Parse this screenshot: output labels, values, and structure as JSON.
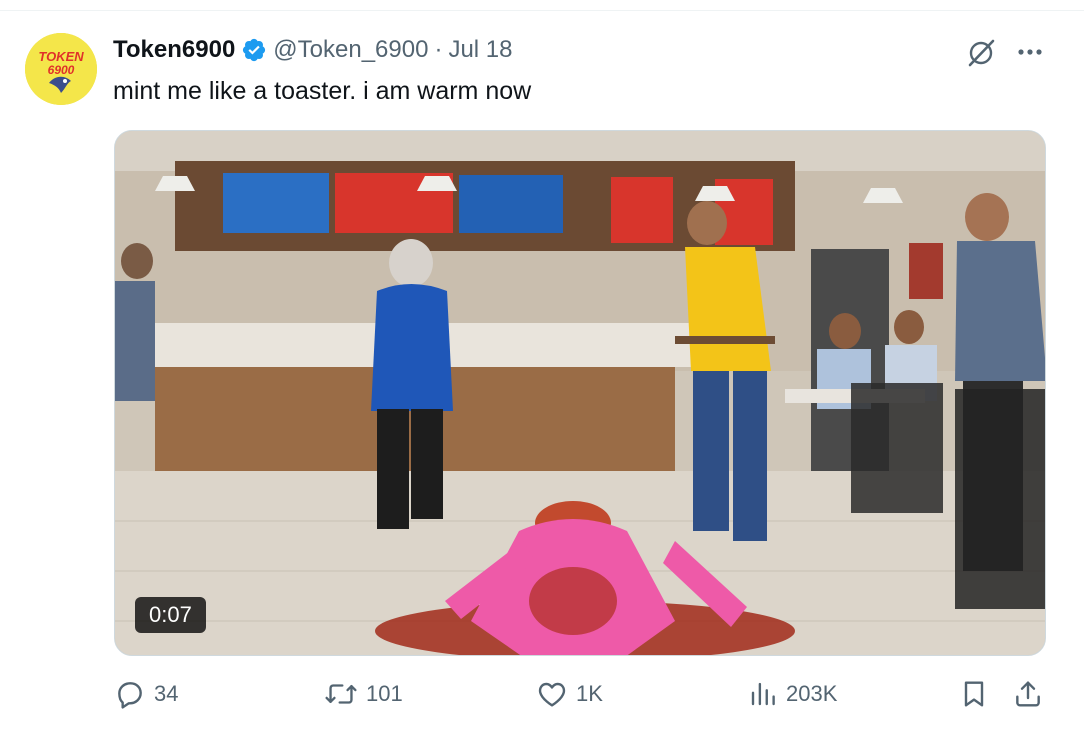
{
  "tweet": {
    "author_name": "Token6900",
    "handle": "@Token_6900",
    "separator": "·",
    "date": "Jul 18",
    "text": "mint me like a toaster. i am warm now",
    "avatar_text": "TOKEN 6900",
    "video_duration": "0:07"
  },
  "stats": {
    "replies": "34",
    "reposts": "101",
    "likes": "1K",
    "views": "203K"
  },
  "icons": {
    "verified": "verified-badge-icon",
    "grok": "grok-icon",
    "more": "more-dots-icon",
    "reply": "reply-icon",
    "repost": "repost-icon",
    "like": "heart-icon",
    "views": "views-bars-icon",
    "bookmark": "bookmark-icon",
    "share": "share-icon"
  },
  "colors": {
    "text_primary": "#0f1419",
    "text_secondary": "#536471",
    "verified_blue": "#1d9bf0",
    "avatar_yellow": "#f4e64a",
    "avatar_red": "#e0312a"
  }
}
